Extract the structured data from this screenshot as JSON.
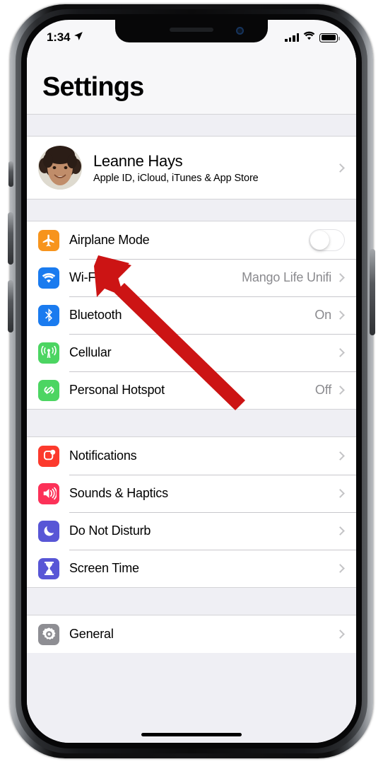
{
  "status_bar": {
    "time": "1:34",
    "location_icon": "location-arrow-icon",
    "signal_icon": "cellular-signal-icon",
    "wifi_icon": "wifi-icon",
    "battery_icon": "battery-icon"
  },
  "header": {
    "title": "Settings"
  },
  "account": {
    "name": "Leanne Hays",
    "subtitle": "Apple ID, iCloud, iTunes & App Store",
    "avatar_name": "profile-photo"
  },
  "groups": [
    {
      "rows": [
        {
          "label": "Airplane Mode",
          "icon": "airplane-icon",
          "color": "#F7941D",
          "control": "toggle",
          "toggle_on": false
        },
        {
          "label": "Wi-Fi",
          "icon": "wifi-icon",
          "color": "#1A7BEF",
          "value": "Mango Life Unifi",
          "control": "chevron"
        },
        {
          "label": "Bluetooth",
          "icon": "bluetooth-icon",
          "color": "#1A7BEF",
          "value": "On",
          "control": "chevron"
        },
        {
          "label": "Cellular",
          "icon": "cellular-antenna-icon",
          "color": "#4CD562",
          "value": "",
          "control": "chevron"
        },
        {
          "label": "Personal Hotspot",
          "icon": "hotspot-link-icon",
          "color": "#4CD562",
          "value": "Off",
          "control": "chevron"
        }
      ]
    },
    {
      "rows": [
        {
          "label": "Notifications",
          "icon": "notifications-icon",
          "color": "#FC3A2D",
          "value": "",
          "control": "chevron"
        },
        {
          "label": "Sounds & Haptics",
          "icon": "speaker-icon",
          "color": "#FC3158",
          "value": "",
          "control": "chevron"
        },
        {
          "label": "Do Not Disturb",
          "icon": "moon-icon",
          "color": "#5856D6",
          "value": "",
          "control": "chevron"
        },
        {
          "label": "Screen Time",
          "icon": "hourglass-icon",
          "color": "#5856D6",
          "value": "",
          "control": "chevron"
        }
      ]
    },
    {
      "rows": [
        {
          "label": "General",
          "icon": "gear-icon",
          "color": "#8E8E93",
          "value": "",
          "control": "chevron"
        }
      ]
    }
  ],
  "annotation": {
    "arrow_color": "#CC1414",
    "arrow_name": "red-annotation-arrow",
    "points_to": "Leanne Hays account row"
  }
}
